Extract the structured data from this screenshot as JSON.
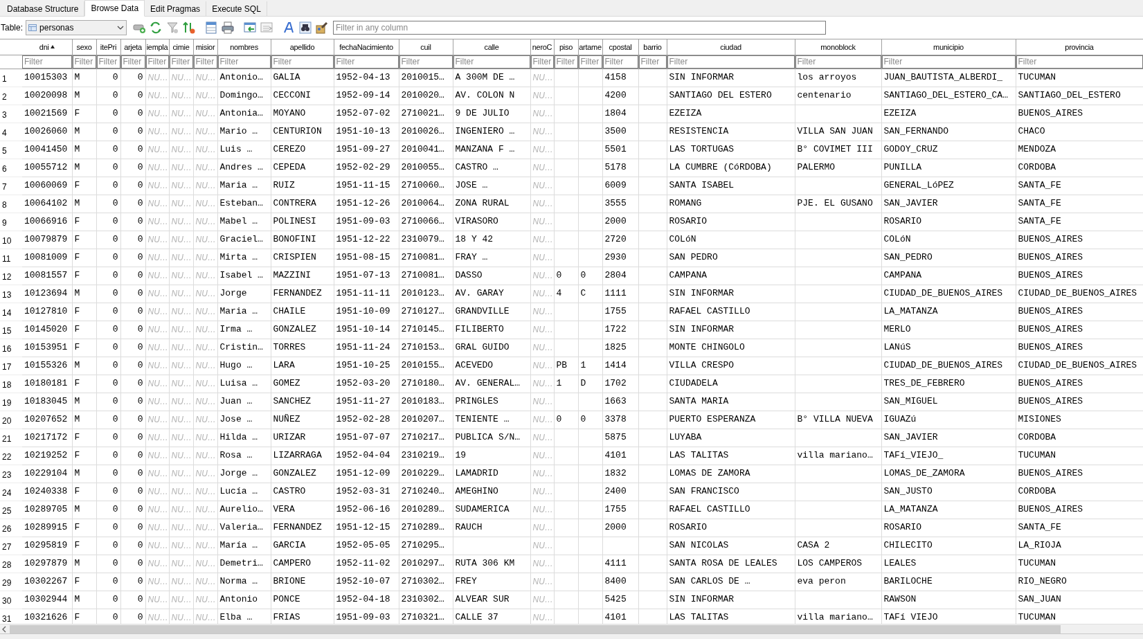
{
  "tabs": [
    {
      "label": "Database Structure",
      "selected": false
    },
    {
      "label": "Browse Data",
      "selected": true
    },
    {
      "label": "Edit Pragmas",
      "selected": false
    },
    {
      "label": "Execute SQL",
      "selected": false
    }
  ],
  "toolbar": {
    "table_label": "Table:",
    "table_value": "personas",
    "filter_placeholder": "Filter in any column"
  },
  "columns": [
    {
      "label": "dni",
      "kind": "text",
      "sorted": true,
      "filter_placeholder": "Filter"
    },
    {
      "label": "sexo",
      "kind": "text",
      "sorted": false,
      "filter_placeholder": "Filter"
    },
    {
      "label": "itePri",
      "kind": "number",
      "sorted": false,
      "filter_placeholder": "Filter"
    },
    {
      "label": "arjeta",
      "kind": "number",
      "sorted": false,
      "filter_placeholder": "Filter"
    },
    {
      "label": "iempla",
      "kind": "null",
      "sorted": false,
      "filter_placeholder": "Filter"
    },
    {
      "label": "cimie",
      "kind": "null",
      "sorted": false,
      "filter_placeholder": "Filter"
    },
    {
      "label": "misior",
      "kind": "null",
      "sorted": false,
      "filter_placeholder": "Filter"
    },
    {
      "label": "nombres",
      "kind": "text",
      "sorted": false,
      "filter_placeholder": "Filter"
    },
    {
      "label": "apellido",
      "kind": "text",
      "sorted": false,
      "filter_placeholder": "Filter"
    },
    {
      "label": "fechaNacimiento",
      "kind": "text",
      "sorted": false,
      "filter_placeholder": "Filter"
    },
    {
      "label": "cuil",
      "kind": "text",
      "sorted": false,
      "filter_placeholder": "Filter"
    },
    {
      "label": "calle",
      "kind": "text",
      "sorted": false,
      "filter_placeholder": "Filter"
    },
    {
      "label": "neroC",
      "kind": "null",
      "sorted": false,
      "filter_placeholder": "Filter"
    },
    {
      "label": "piso",
      "kind": "text",
      "sorted": false,
      "filter_placeholder": "Filter"
    },
    {
      "label": "artame",
      "kind": "text",
      "sorted": false,
      "filter_placeholder": "Filter"
    },
    {
      "label": "cpostal",
      "kind": "text",
      "sorted": false,
      "filter_placeholder": "Filter"
    },
    {
      "label": "barrio",
      "kind": "text",
      "sorted": false,
      "filter_placeholder": "Filter"
    },
    {
      "label": "ciudad",
      "kind": "text",
      "sorted": false,
      "filter_placeholder": "Filter"
    },
    {
      "label": "monoblock",
      "kind": "text",
      "sorted": false,
      "filter_placeholder": "Filter"
    },
    {
      "label": "municipio",
      "kind": "text",
      "sorted": false,
      "filter_placeholder": "Filter"
    },
    {
      "label": "provincia",
      "kind": "text",
      "sorted": false,
      "filter_placeholder": "Filter"
    }
  ],
  "rows": [
    {
      "number": "1",
      "cells": [
        "10015303",
        "M",
        "0",
        "0",
        "NU…",
        "NU…",
        "NU…",
        "Antonio…",
        "GALIA",
        "1952-04-13",
        "2010015…",
        "A 300M DE …",
        "NU…",
        null,
        null,
        "4158",
        null,
        "SIN INFORMAR",
        "los arroyos",
        "JUAN_BAUTISTA_ALBERDI_",
        "TUCUMAN"
      ]
    },
    {
      "number": "2",
      "cells": [
        "10020098",
        "M",
        "0",
        "0",
        "NU…",
        "NU…",
        "NU…",
        "Domingo…",
        "CECCONI",
        "1952-09-14",
        "2010020…",
        "AV. COLON N",
        "NU…",
        null,
        null,
        "4200",
        null,
        "SANTIAGO DEL ESTERO",
        "centenario",
        "SANTIAGO_DEL_ESTERO_CA…",
        "SANTIAGO_DEL_ESTERO"
      ]
    },
    {
      "number": "3",
      "cells": [
        "10021569",
        "F",
        "0",
        "0",
        "NU…",
        "NU…",
        "NU…",
        "Antonia…",
        "MOYANO",
        "1952-07-02",
        "2710021…",
        "9 DE JULIO",
        "NU…",
        null,
        null,
        "1804",
        null,
        "EZEIZA",
        null,
        "EZEIZA",
        "BUENOS_AIRES"
      ]
    },
    {
      "number": "4",
      "cells": [
        "10026060",
        "M",
        "0",
        "0",
        "NU…",
        "NU…",
        "NU…",
        "Mario …",
        "CENTURION",
        "1951-10-13",
        "2010026…",
        "INGENIERO …",
        "NU…",
        null,
        null,
        "3500",
        null,
        "RESISTENCIA",
        "VILLA SAN JUAN",
        "SAN_FERNANDO",
        "CHACO"
      ]
    },
    {
      "number": "5",
      "cells": [
        "10041450",
        "M",
        "0",
        "0",
        "NU…",
        "NU…",
        "NU…",
        "Luis …",
        "CEREZO",
        "1951-09-27",
        "2010041…",
        "MANZANA F …",
        "NU…",
        null,
        null,
        "5501",
        null,
        "LAS TORTUGAS",
        "B° COVIMET III",
        "GODOY_CRUZ",
        "MENDOZA"
      ]
    },
    {
      "number": "6",
      "cells": [
        "10055712",
        "M",
        "0",
        "0",
        "NU…",
        "NU…",
        "NU…",
        "Andres …",
        "CEPEDA",
        "1952-02-29",
        "2010055…",
        "CASTRO …",
        "NU…",
        null,
        null,
        "5178",
        null,
        "LA CUMBRE (CóRDOBA)",
        "PALERMO",
        "PUNILLA",
        "CORDOBA"
      ]
    },
    {
      "number": "7",
      "cells": [
        "10060069",
        "F",
        "0",
        "0",
        "NU…",
        "NU…",
        "NU…",
        "Maria …",
        "RUIZ",
        "1951-11-15",
        "2710060…",
        "JOSE …",
        "NU…",
        null,
        null,
        "6009",
        null,
        "SANTA ISABEL",
        null,
        "GENERAL_LóPEZ",
        "SANTA_FE"
      ]
    },
    {
      "number": "8",
      "cells": [
        "10064102",
        "M",
        "0",
        "0",
        "NU…",
        "NU…",
        "NU…",
        "Esteban…",
        "CONTRERA",
        "1951-12-26",
        "2010064…",
        "ZONA RURAL",
        "NU…",
        null,
        null,
        "3555",
        null,
        "ROMANG",
        "PJE. EL GUSANO",
        "SAN_JAVIER",
        "SANTA_FE"
      ]
    },
    {
      "number": "9",
      "cells": [
        "10066916",
        "F",
        "0",
        "0",
        "NU…",
        "NU…",
        "NU…",
        "Mabel …",
        "POLINESI",
        "1951-09-03",
        "2710066…",
        "VIRASORO",
        "NU…",
        null,
        null,
        "2000",
        null,
        "ROSARIO",
        null,
        "ROSARIO",
        "SANTA_FE"
      ]
    },
    {
      "number": "10",
      "cells": [
        "10079879",
        "F",
        "0",
        "0",
        "NU…",
        "NU…",
        "NU…",
        "Graciel…",
        "BONOFINI",
        "1951-12-22",
        "2310079…",
        "18 Y 42",
        "NU…",
        null,
        null,
        "2720",
        null,
        "COLóN",
        null,
        "COLóN",
        "BUENOS_AIRES"
      ]
    },
    {
      "number": "11",
      "cells": [
        "10081009",
        "F",
        "0",
        "0",
        "NU…",
        "NU…",
        "NU…",
        "Mirta …",
        "CRISPIEN",
        "1951-08-15",
        "2710081…",
        "FRAY …",
        "NU…",
        null,
        null,
        "2930",
        null,
        "SAN PEDRO",
        null,
        "SAN_PEDRO",
        "BUENOS_AIRES"
      ]
    },
    {
      "number": "12",
      "cells": [
        "10081557",
        "F",
        "0",
        "0",
        "NU…",
        "NU…",
        "NU…",
        "Isabel …",
        "MAZZINI",
        "1951-07-13",
        "2710081…",
        "DASSO",
        "NU…",
        "0",
        "0",
        "2804",
        null,
        "CAMPANA",
        null,
        "CAMPANA",
        "BUENOS_AIRES"
      ]
    },
    {
      "number": "13",
      "cells": [
        "10123694",
        "M",
        "0",
        "0",
        "NU…",
        "NU…",
        "NU…",
        "Jorge",
        "FERNANDEZ",
        "1951-11-11",
        "2010123…",
        "AV. GARAY",
        "NU…",
        "4",
        "C",
        "1111",
        null,
        "SIN INFORMAR",
        null,
        "CIUDAD_DE_BUENOS_AIRES",
        "CIUDAD_DE_BUENOS_AIRES"
      ]
    },
    {
      "number": "14",
      "cells": [
        "10127810",
        "F",
        "0",
        "0",
        "NU…",
        "NU…",
        "NU…",
        "Maria …",
        "CHAILE",
        "1951-10-09",
        "2710127…",
        "GRANDVILLE",
        "NU…",
        null,
        null,
        "1755",
        null,
        "RAFAEL CASTILLO",
        null,
        "LA_MATANZA",
        "BUENOS_AIRES"
      ]
    },
    {
      "number": "15",
      "cells": [
        "10145020",
        "F",
        "0",
        "0",
        "NU…",
        "NU…",
        "NU…",
        "Irma …",
        "GONZALEZ",
        "1951-10-14",
        "2710145…",
        "FILIBERTO",
        "NU…",
        null,
        null,
        "1722",
        null,
        "SIN INFORMAR",
        null,
        "MERLO",
        "BUENOS_AIRES"
      ]
    },
    {
      "number": "16",
      "cells": [
        "10153951",
        "F",
        "0",
        "0",
        "NU…",
        "NU…",
        "NU…",
        "Cristin…",
        "TORRES",
        "1951-11-24",
        "2710153…",
        "GRAL GUIDO",
        "NU…",
        null,
        null,
        "1825",
        null,
        "MONTE CHINGOLO",
        null,
        "LANúS",
        "BUENOS_AIRES"
      ]
    },
    {
      "number": "17",
      "cells": [
        "10155326",
        "M",
        "0",
        "0",
        "NU…",
        "NU…",
        "NU…",
        "Hugo …",
        "LARA",
        "1951-10-25",
        "2010155…",
        "ACEVEDO",
        "NU…",
        "PB",
        "1",
        "1414",
        null,
        "VILLA CRESPO",
        null,
        "CIUDAD_DE_BUENOS_AIRES",
        "CIUDAD_DE_BUENOS_AIRES"
      ]
    },
    {
      "number": "18",
      "cells": [
        "10180181",
        "F",
        "0",
        "0",
        "NU…",
        "NU…",
        "NU…",
        "Luisa …",
        "GOMEZ",
        "1952-03-20",
        "2710180…",
        "AV. GENERAL…",
        "NU…",
        "1",
        "D",
        "1702",
        null,
        "CIUDADELA",
        null,
        "TRES_DE_FEBRERO",
        "BUENOS_AIRES"
      ]
    },
    {
      "number": "19",
      "cells": [
        "10183045",
        "M",
        "0",
        "0",
        "NU…",
        "NU…",
        "NU…",
        "Juan …",
        "SANCHEZ",
        "1951-11-27",
        "2010183…",
        "PRINGLES",
        "NU…",
        null,
        null,
        "1663",
        null,
        "SANTA MARIA",
        null,
        "SAN_MIGUEL",
        "BUENOS_AIRES"
      ]
    },
    {
      "number": "20",
      "cells": [
        "10207652",
        "M",
        "0",
        "0",
        "NU…",
        "NU…",
        "NU…",
        "Jose …",
        "NUÑEZ",
        "1952-02-28",
        "2010207…",
        "TENIENTE …",
        "NU…",
        "0",
        "0",
        "3378",
        null,
        "PUERTO ESPERANZA",
        "B° VILLA NUEVA",
        "IGUAZú",
        "MISIONES"
      ]
    },
    {
      "number": "21",
      "cells": [
        "10217172",
        "F",
        "0",
        "0",
        "NU…",
        "NU…",
        "NU…",
        "Hilda …",
        "URIZAR",
        "1951-07-07",
        "2710217…",
        "PUBLICA S/N…",
        "NU…",
        null,
        null,
        "5875",
        null,
        "LUYABA",
        null,
        "SAN_JAVIER",
        "CORDOBA"
      ]
    },
    {
      "number": "22",
      "cells": [
        "10219252",
        "F",
        "0",
        "0",
        "NU…",
        "NU…",
        "NU…",
        "Rosa …",
        "LIZARRAGA",
        "1952-04-04",
        "2310219…",
        "19",
        "NU…",
        null,
        null,
        "4101",
        null,
        "LAS TALITAS",
        "villa mariano…",
        "TAFí_VIEJO_",
        "TUCUMAN"
      ]
    },
    {
      "number": "23",
      "cells": [
        "10229104",
        "M",
        "0",
        "0",
        "NU…",
        "NU…",
        "NU…",
        "Jorge …",
        "GONZALEZ",
        "1951-12-09",
        "2010229…",
        "LAMADRID",
        "NU…",
        null,
        null,
        "1832",
        null,
        "LOMAS DE ZAMORA",
        null,
        "LOMAS_DE_ZAMORA",
        "BUENOS_AIRES"
      ]
    },
    {
      "number": "24",
      "cells": [
        "10240338",
        "F",
        "0",
        "0",
        "NU…",
        "NU…",
        "NU…",
        "Lucía …",
        "CASTRO",
        "1952-03-31",
        "2710240…",
        "AMEGHINO",
        "NU…",
        null,
        null,
        "2400",
        null,
        "SAN FRANCISCO",
        null,
        "SAN_JUSTO",
        "CORDOBA"
      ]
    },
    {
      "number": "25",
      "cells": [
        "10289705",
        "M",
        "0",
        "0",
        "NU…",
        "NU…",
        "NU…",
        "Aurelio…",
        "VERA",
        "1952-06-16",
        "2010289…",
        "SUDAMERICA",
        "NU…",
        null,
        null,
        "1755",
        null,
        "RAFAEL CASTILLO",
        null,
        "LA_MATANZA",
        "BUENOS_AIRES"
      ]
    },
    {
      "number": "26",
      "cells": [
        "10289915",
        "F",
        "0",
        "0",
        "NU…",
        "NU…",
        "NU…",
        "Valeria…",
        "FERNANDEZ",
        "1951-12-15",
        "2710289…",
        "RAUCH",
        "NU…",
        null,
        null,
        "2000",
        null,
        "ROSARIO",
        null,
        "ROSARIO",
        "SANTA_FE"
      ]
    },
    {
      "number": "27",
      "cells": [
        "10295819",
        "F",
        "0",
        "0",
        "NU…",
        "NU…",
        "NU…",
        "María …",
        "GARCIA",
        "1952-05-05",
        "2710295…",
        null,
        "NU…",
        null,
        null,
        null,
        null,
        "SAN NICOLAS",
        "CASA 2",
        "CHILECITO",
        "LA_RIOJA"
      ]
    },
    {
      "number": "28",
      "cells": [
        "10297879",
        "M",
        "0",
        "0",
        "NU…",
        "NU…",
        "NU…",
        "Demetri…",
        "CAMPERO",
        "1952-11-02",
        "2010297…",
        "RUTA 306 KM",
        "NU…",
        null,
        null,
        "4111",
        null,
        "SANTA ROSA DE LEALES",
        "LOS CAMPEROS",
        "LEALES",
        "TUCUMAN"
      ]
    },
    {
      "number": "29",
      "cells": [
        "10302267",
        "F",
        "0",
        "0",
        "NU…",
        "NU…",
        "NU…",
        "Norma …",
        "BRIONE",
        "1952-10-07",
        "2710302…",
        "FREY",
        "NU…",
        null,
        null,
        "8400",
        null,
        "SAN CARLOS DE …",
        "eva peron",
        "BARILOCHE",
        "RIO_NEGRO"
      ]
    },
    {
      "number": "30",
      "cells": [
        "10302944",
        "M",
        "0",
        "0",
        "NU…",
        "NU…",
        "NU…",
        "Antonio",
        "PONCE",
        "1952-04-18",
        "2310302…",
        "ALVEAR SUR",
        "NU…",
        null,
        null,
        "5425",
        null,
        "SIN INFORMAR",
        null,
        "RAWSON",
        "SAN_JUAN"
      ]
    },
    {
      "number": "31",
      "cells": [
        "10321626",
        "F",
        "0",
        "0",
        "NU…",
        "NU…",
        "NU…",
        "Elba …",
        "FRIAS",
        "1951-09-03",
        "2710321…",
        "CALLE 37",
        "NU…",
        null,
        null,
        "4101",
        null,
        "LAS TALITAS",
        "villa mariano…",
        "TAFí VIEJO",
        "TUCUMAN"
      ]
    }
  ]
}
